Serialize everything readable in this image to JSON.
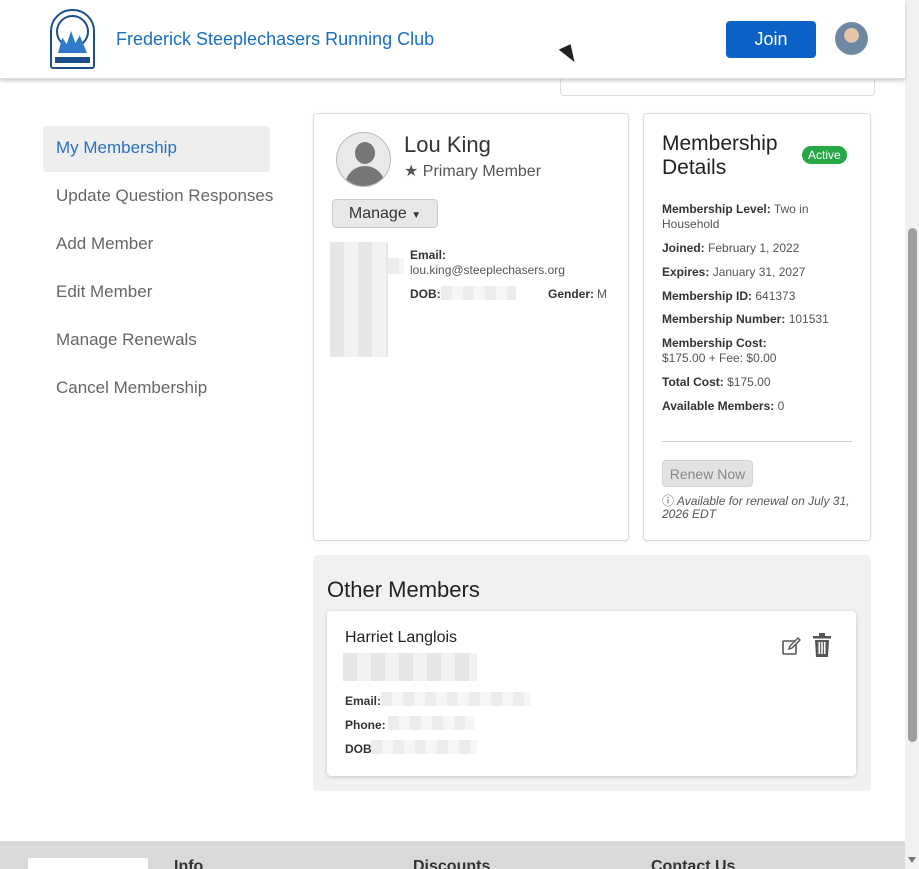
{
  "header": {
    "site_title": "Frederick Steeplechasers Running Club",
    "join_label": "Join"
  },
  "sidenav": {
    "items": [
      {
        "label": "My Membership",
        "active": true
      },
      {
        "label": "Update Question Responses"
      },
      {
        "label": "Add Member"
      },
      {
        "label": "Edit Member"
      },
      {
        "label": "Manage Renewals"
      },
      {
        "label": "Cancel Membership"
      }
    ]
  },
  "profile": {
    "name": "Lou King",
    "role": "Primary Member",
    "manage_label": "Manage",
    "email_label": "Email:",
    "email_value": "lou.king@steeplechasers.org",
    "dob_label": "DOB:",
    "gender_label": "Gender:",
    "gender_value": "M"
  },
  "membership": {
    "title": "Membership Details",
    "status": "Active",
    "level_label": "Membership Level:",
    "level_value": "Two in Household",
    "joined_label": "Joined:",
    "joined_value": "February 1, 2022",
    "expires_label": "Expires:",
    "expires_value": "January 31, 2027",
    "id_label": "Membership ID:",
    "id_value": "641373",
    "number_label": "Membership Number:",
    "number_value": "101531",
    "cost_label": "Membership Cost:",
    "cost_value": "$175.00 + Fee: $0.00",
    "total_label": "Total Cost:",
    "total_value": "$175.00",
    "available_label": "Available Members:",
    "available_value": "0",
    "renew_label": "Renew Now",
    "renew_note": "Available for renewal on July 31, 2026 EDT"
  },
  "other_members": {
    "title": "Other Members",
    "member": {
      "name": "Harriet Langlois",
      "email_label": "Email:",
      "phone_label": "Phone:",
      "dob_label": "DOB"
    }
  },
  "footer": {
    "col1": "Info",
    "col2": "Discounts",
    "col3": "Contact Us"
  }
}
